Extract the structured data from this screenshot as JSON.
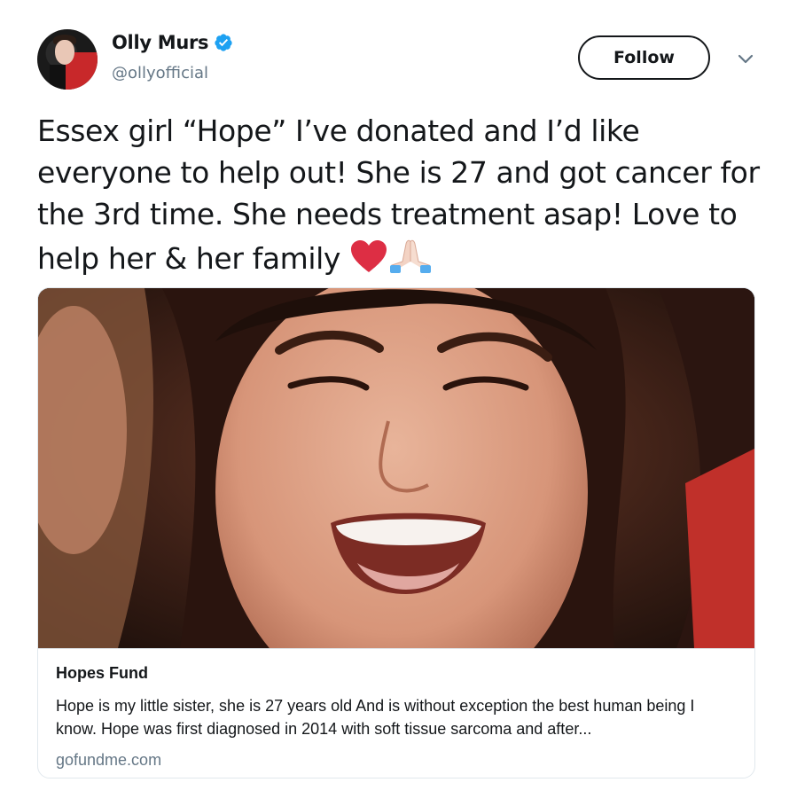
{
  "author": {
    "display_name": "Olly Murs",
    "handle": "@ollyofficial",
    "verified": true,
    "avatar_icon": "user-avatar"
  },
  "actions": {
    "follow_label": "Follow",
    "menu_icon": "chevron-down-icon"
  },
  "tweet": {
    "text": "Essex girl “Hope” I’ve donated and I’d like everyone to help out! She is 27 and got cancer for the 3rd time. She needs treatment asap! Love to help her & her family",
    "emojis": [
      "red-heart",
      "folded-hands"
    ]
  },
  "card": {
    "title": "Hopes Fund",
    "description": "Hope is my little sister, she is 27 years old And is without exception the best human being I know. Hope was first diagnosed in 2014 with soft tissue sarcoma and after...",
    "domain": "gofundme.com"
  },
  "colors": {
    "verified": "#1da1f2",
    "secondary_text": "#657786",
    "heart": "#dd2e44",
    "border": "#e1e8ed"
  }
}
